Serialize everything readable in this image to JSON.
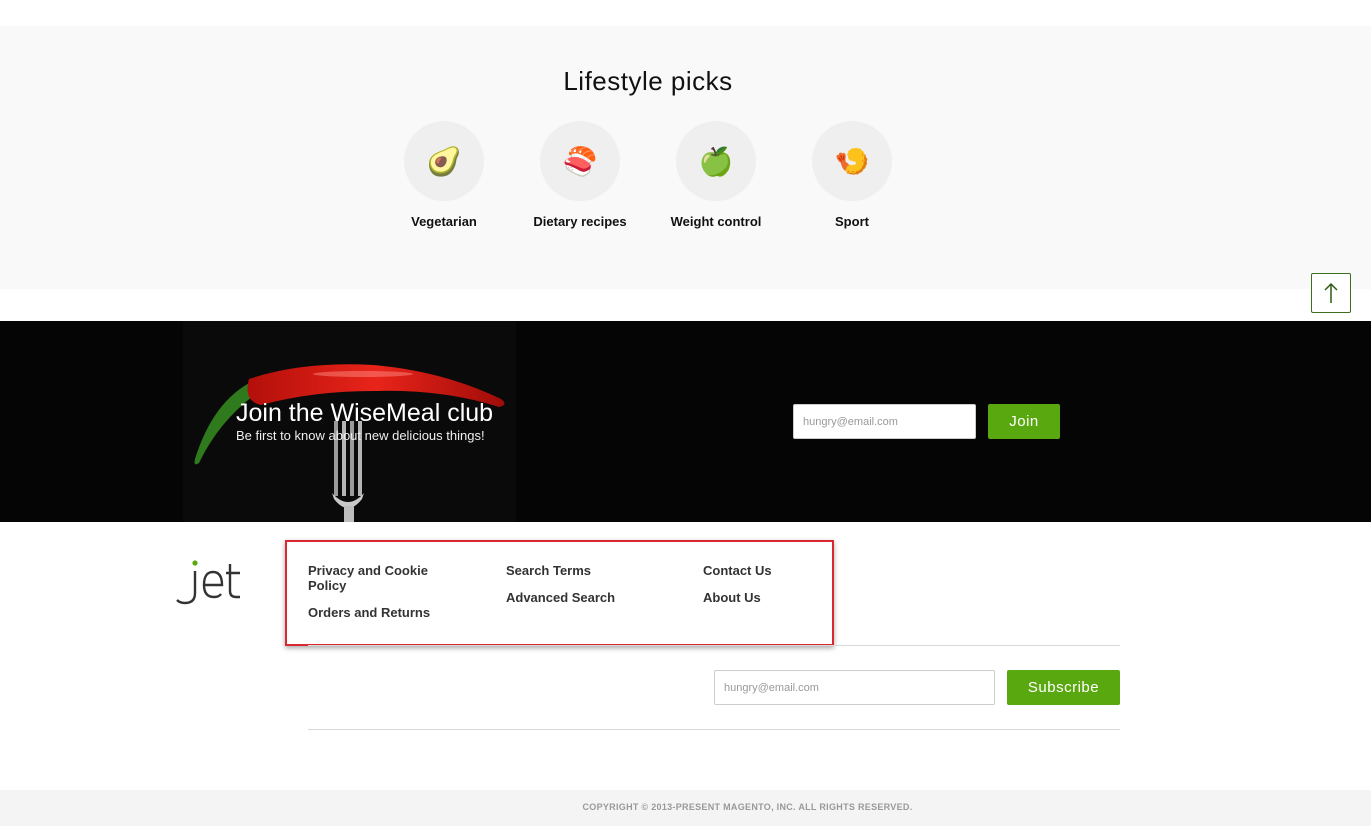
{
  "lifestyle": {
    "title": "Lifestyle picks",
    "items": [
      {
        "label": "Vegetarian",
        "icon": "avocado-icon",
        "glyph": "🥑"
      },
      {
        "label": "Dietary recipes",
        "icon": "sushi-icon",
        "glyph": "🍣"
      },
      {
        "label": "Weight control",
        "icon": "green-apple-icon",
        "glyph": "🍏"
      },
      {
        "label": "Sport",
        "icon": "shrimp-icon",
        "glyph": "🍤"
      }
    ]
  },
  "scroll_top": {
    "icon": "arrow-up-icon"
  },
  "club": {
    "title": "Join the WiseMeal club",
    "subtitle": "Be first to know about new delicious things!",
    "email_placeholder": "hungry@email.com",
    "join_label": "Join"
  },
  "footer": {
    "logo_text": "jet",
    "links": {
      "col1": [
        "Privacy and Cookie Policy",
        "Orders and Returns"
      ],
      "col2": [
        "Search Terms",
        "Advanced Search"
      ],
      "col3": [
        "Contact Us",
        "About Us"
      ]
    },
    "subscribe": {
      "email_placeholder": "hungry@email.com",
      "button_label": "Subscribe"
    },
    "copyright": "COPYRIGHT © 2013-PRESENT MAGENTO, INC. ALL RIGHTS RESERVED."
  },
  "colors": {
    "accent_green": "#5aa80f",
    "highlight_red": "#d9282f",
    "banner_bg": "#050505"
  }
}
